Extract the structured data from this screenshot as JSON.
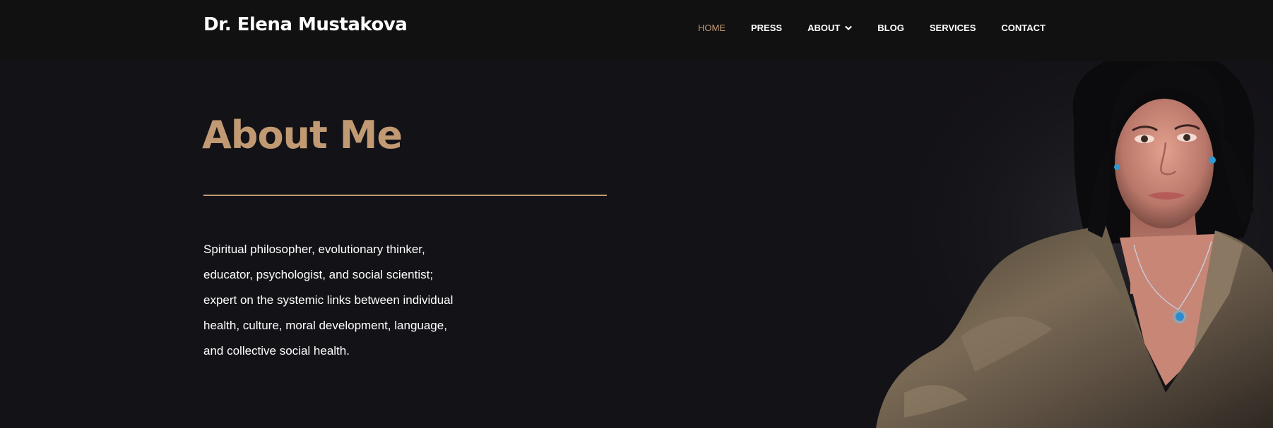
{
  "header": {
    "site_title": "Dr. Elena Mustakova",
    "nav": [
      {
        "label": "HOME",
        "active": true
      },
      {
        "label": "PRESS",
        "active": false
      },
      {
        "label": "ABOUT",
        "active": false,
        "has_dropdown": true
      },
      {
        "label": "BLOG",
        "active": false
      },
      {
        "label": "SERVICES",
        "active": false
      },
      {
        "label": "CONTACT",
        "active": false
      }
    ]
  },
  "hero": {
    "title": "About Me",
    "bio_lines": [
      "Spiritual philosopher, evolutionary thinker,",
      "educator, psychologist, and social scientist;",
      "expert on the systemic links between individual",
      "health, culture, moral development, language,",
      "and collective social health."
    ]
  },
  "colors": {
    "accent": "#c19a73",
    "background": "#131217",
    "header_background": "#111111",
    "text": "#ffffff"
  },
  "icons": {
    "about_dropdown": "chevron-down-icon"
  }
}
